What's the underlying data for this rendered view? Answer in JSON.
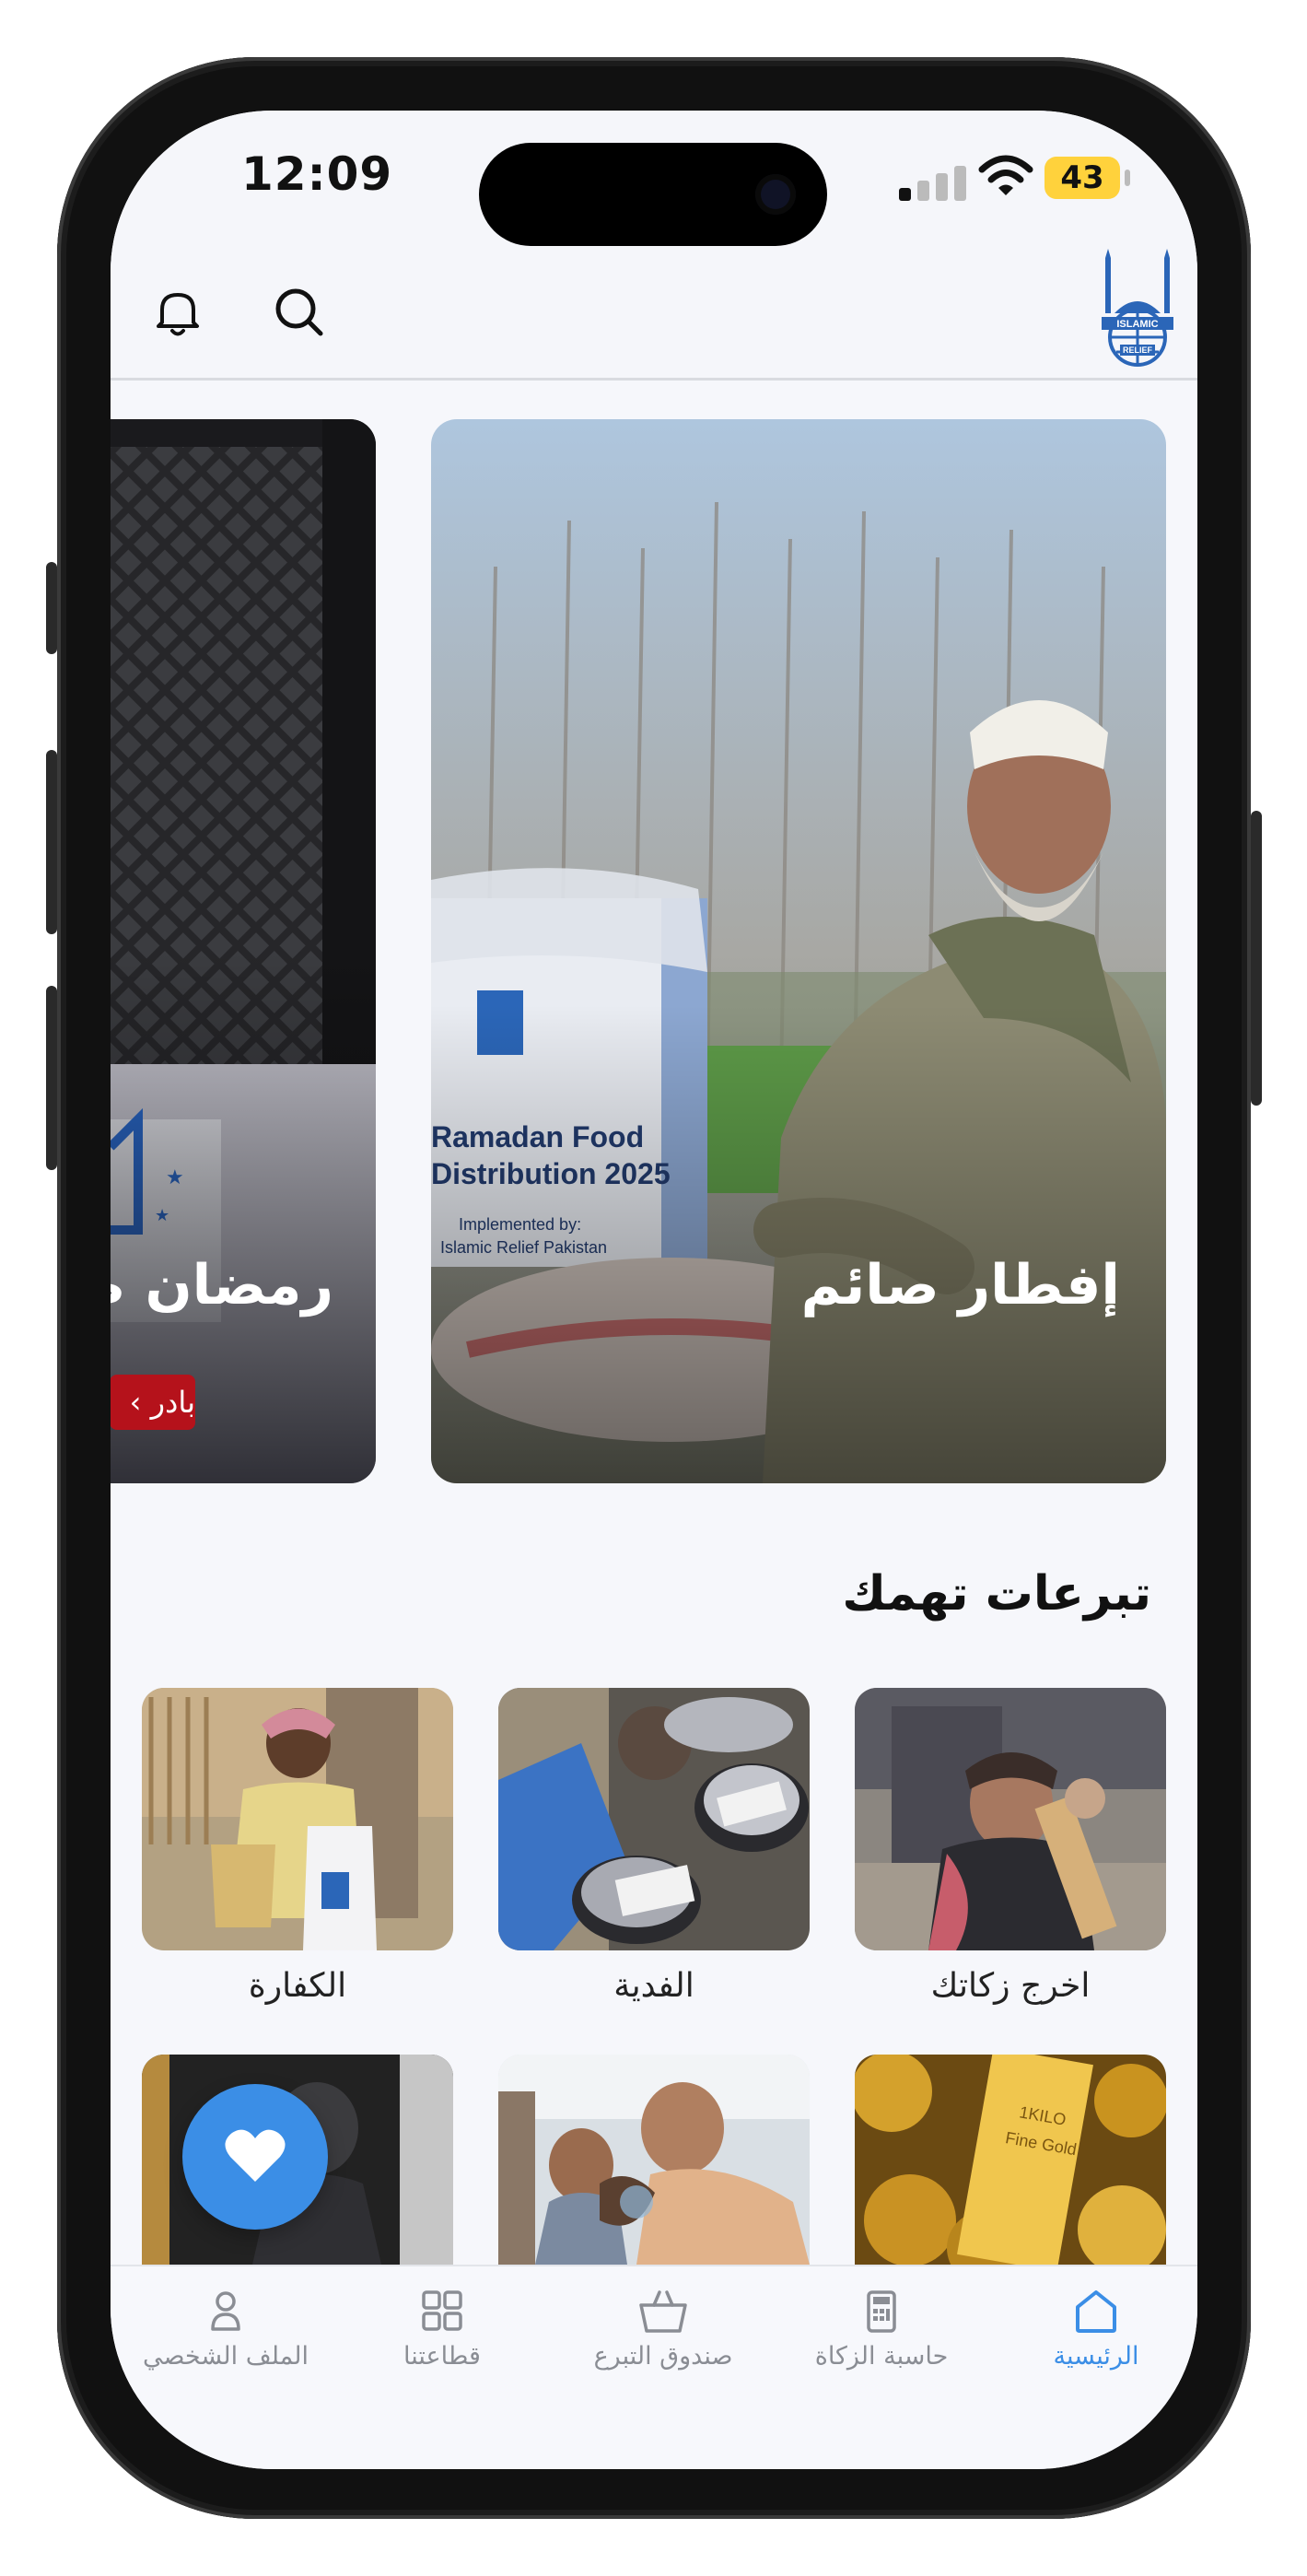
{
  "status_bar": {
    "time": "12:09",
    "battery": "43",
    "battery_color": "#ffd23c"
  },
  "header": {
    "logo_text": "ISLAMIC RELIEF",
    "icons": [
      "bell-icon",
      "search-icon"
    ]
  },
  "hero": {
    "slides": [
      {
        "title": "إفطار صائم",
        "image": "elderly man with Ramadan Food Distribution 2025 box"
      },
      {
        "title": "رمضان صا",
        "button_label": "بادر",
        "image": "food box with Islamic Relief logo"
      }
    ]
  },
  "section": {
    "title": "تبرعات تهمك",
    "tiles": [
      {
        "label": "اخرج زكاتك"
      },
      {
        "label": "الفدية"
      },
      {
        "label": "الكفارة"
      },
      {
        "label": ""
      },
      {
        "label": ""
      },
      {
        "label": ""
      }
    ]
  },
  "fab": {
    "icon": "heart-icon",
    "color": "#3b8ee6"
  },
  "tabbar": {
    "active_color": "#3b8ee6",
    "items": [
      {
        "label": "الرئيسية",
        "icon": "home-icon",
        "active": true
      },
      {
        "label": "حاسبة الزكاة",
        "icon": "calculator-icon",
        "active": false
      },
      {
        "label": "صندوق التبرع",
        "icon": "basket-icon",
        "active": false
      },
      {
        "label": "قطاعتنا",
        "icon": "grid-icon",
        "active": false
      },
      {
        "label": "الملف الشخصي",
        "icon": "user-icon",
        "active": false
      }
    ]
  }
}
